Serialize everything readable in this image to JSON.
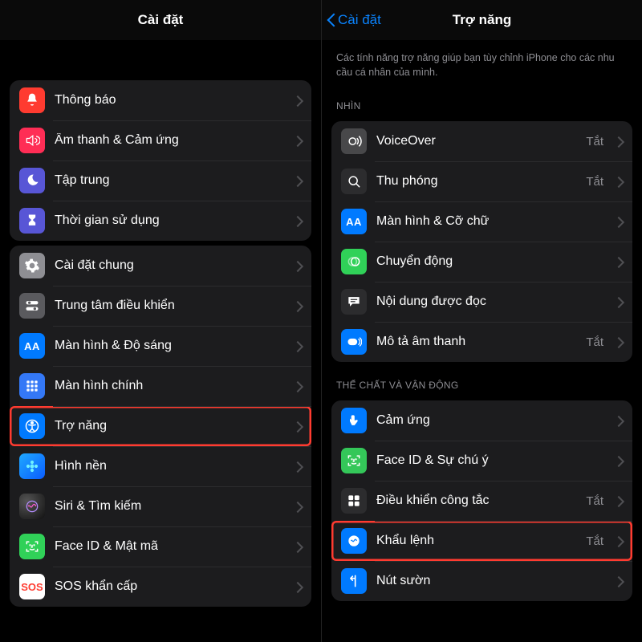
{
  "left": {
    "header_title": "Cài đặt",
    "group1": {
      "notifications": "Thông báo",
      "sound": "Âm thanh & Cảm ứng",
      "focus": "Tập trung",
      "screentime": "Thời gian sử dụng"
    },
    "group2": {
      "general": "Cài đặt chung",
      "control": "Trung tâm điều khiển",
      "display": "Màn hình & Độ sáng",
      "aa": "AA",
      "home": "Màn hình chính",
      "accessibility": "Trợ năng",
      "wallpaper": "Hình nền",
      "siri": "Siri & Tìm kiếm",
      "faceid": "Face ID & Mật mã",
      "sos": "SOS khẩn cấp",
      "sos_txt": "SOS"
    }
  },
  "right": {
    "back": "Cài đặt",
    "header_title": "Trợ năng",
    "desc": "Các tính năng trợ năng giúp bạn tùy chỉnh iPhone cho các nhu cầu cá nhân của mình.",
    "section_vision": "NHÌN",
    "off": "Tắt",
    "vision": {
      "voiceover": "VoiceOver",
      "zoom": "Thu phóng",
      "text": "Màn hình & Cỡ chữ",
      "aa": "AA",
      "motion": "Chuyển động",
      "spoken": "Nội dung được đọc",
      "audiodesc": "Mô tả âm thanh"
    },
    "section_physical": "THỂ CHẤT VÀ VẬN ĐỘNG",
    "physical": {
      "touch": "Cảm ứng",
      "face": "Face ID & Sự chú ý",
      "switch": "Điều khiển công tắc",
      "voice": "Khẩu lệnh",
      "side": "Nút sườn"
    }
  }
}
